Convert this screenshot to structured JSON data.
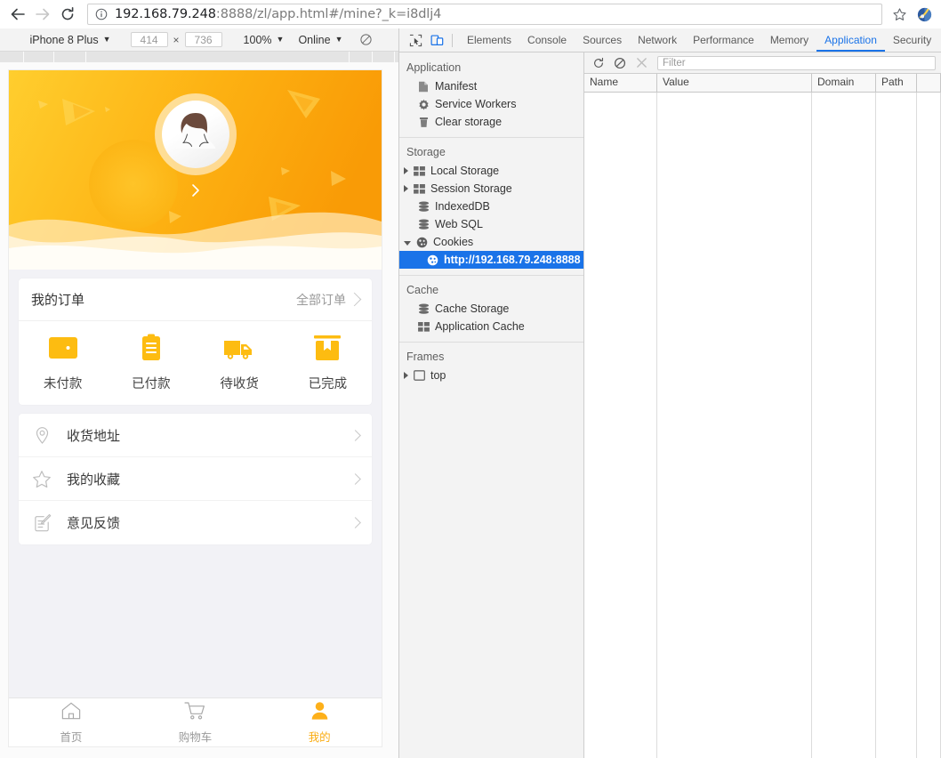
{
  "browser": {
    "back_label": "Back",
    "forward_label": "Forward",
    "reload_label": "Reload",
    "url_host": "192.168.79.248",
    "url_rest": ":8888/zl/app.html#/mine?_k=i8dlj4",
    "url_full": "192.168.79.248:8888/zl/app.html#/mine?_k=i8dlj4",
    "site_info_icon": "info-circle-icon",
    "bookmark_icon": "star-icon",
    "extension_icon": "extension-icon"
  },
  "device_toolbar": {
    "device_name": "iPhone 8 Plus",
    "width": "414",
    "height": "736",
    "zoom": "100%",
    "throttling": "Online",
    "rotate_icon": "rotate-icon"
  },
  "phone": {
    "banner": {
      "avatar_icon": "user-avatar-icon",
      "next_arrow_icon": "chevron-right-icon"
    },
    "orders_card": {
      "title": "我的订单",
      "more_label": "全部订单",
      "more_chevron_icon": "chevron-right-icon",
      "items": [
        {
          "label": "未付款",
          "icon": "wallet-icon"
        },
        {
          "label": "已付款",
          "icon": "clipboard-icon"
        },
        {
          "label": "待收货",
          "icon": "truck-icon"
        },
        {
          "label": "已完成",
          "icon": "box-icon"
        }
      ]
    },
    "menu": [
      {
        "label": "收货地址",
        "icon": "location-pin-icon"
      },
      {
        "label": "我的收藏",
        "icon": "star-outline-icon"
      },
      {
        "label": "意见反馈",
        "icon": "feedback-edit-icon"
      }
    ],
    "tabbar": [
      {
        "label": "首页",
        "icon": "home-icon",
        "active": false
      },
      {
        "label": "购物车",
        "icon": "cart-icon",
        "active": false
      },
      {
        "label": "我的",
        "icon": "person-icon",
        "active": true
      }
    ]
  },
  "devtools": {
    "inspect_icon": "inspect-cursor-icon",
    "device_toggle_icon": "device-toolbar-icon",
    "tabs": [
      {
        "label": "Elements",
        "active": false
      },
      {
        "label": "Console",
        "active": false
      },
      {
        "label": "Sources",
        "active": false
      },
      {
        "label": "Network",
        "active": false
      },
      {
        "label": "Performance",
        "active": false
      },
      {
        "label": "Memory",
        "active": false
      },
      {
        "label": "Application",
        "active": true
      },
      {
        "label": "Security",
        "active": false
      }
    ],
    "sidebar": {
      "groups": [
        {
          "title": "Application",
          "items": [
            {
              "label": "Manifest",
              "icon": "document-icon",
              "expandable": false,
              "selected": false
            },
            {
              "label": "Service Workers",
              "icon": "gear-icon",
              "expandable": false,
              "selected": false
            },
            {
              "label": "Clear storage",
              "icon": "trash-icon",
              "expandable": false,
              "selected": false
            }
          ]
        },
        {
          "title": "Storage",
          "items": [
            {
              "label": "Local Storage",
              "icon": "table-icon",
              "expandable": true,
              "expanded": false,
              "selected": false
            },
            {
              "label": "Session Storage",
              "icon": "table-icon",
              "expandable": true,
              "expanded": false,
              "selected": false
            },
            {
              "label": "IndexedDB",
              "icon": "database-icon",
              "expandable": false,
              "selected": false
            },
            {
              "label": "Web SQL",
              "icon": "database-icon",
              "expandable": false,
              "selected": false
            },
            {
              "label": "Cookies",
              "icon": "cookie-icon",
              "expandable": true,
              "expanded": true,
              "selected": false
            },
            {
              "label": "http://192.168.79.248:8888",
              "icon": "cookie-icon",
              "child": true,
              "selected": true
            }
          ]
        },
        {
          "title": "Cache",
          "items": [
            {
              "label": "Cache Storage",
              "icon": "database-icon",
              "expandable": false,
              "selected": false
            },
            {
              "label": "Application Cache",
              "icon": "table-icon",
              "expandable": false,
              "selected": false
            }
          ]
        },
        {
          "title": "Frames",
          "items": [
            {
              "label": "top",
              "icon": "frame-icon",
              "expandable": true,
              "expanded": false,
              "selected": false
            }
          ]
        }
      ]
    },
    "cookie_panel": {
      "refresh_icon": "refresh-icon",
      "clear_icon": "clear-all-icon",
      "delete_icon": "delete-selected-icon",
      "filter_placeholder": "Filter",
      "filter_value": "",
      "columns": [
        "Name",
        "Value",
        "Domain",
        "Path"
      ],
      "rows": []
    }
  },
  "colors": {
    "accent_orange": "#faad14",
    "banner_from": "#ffcf2d",
    "banner_to": "#f99e09",
    "devtools_blue": "#1a73e8",
    "page_bg": "#f2f2f6"
  }
}
